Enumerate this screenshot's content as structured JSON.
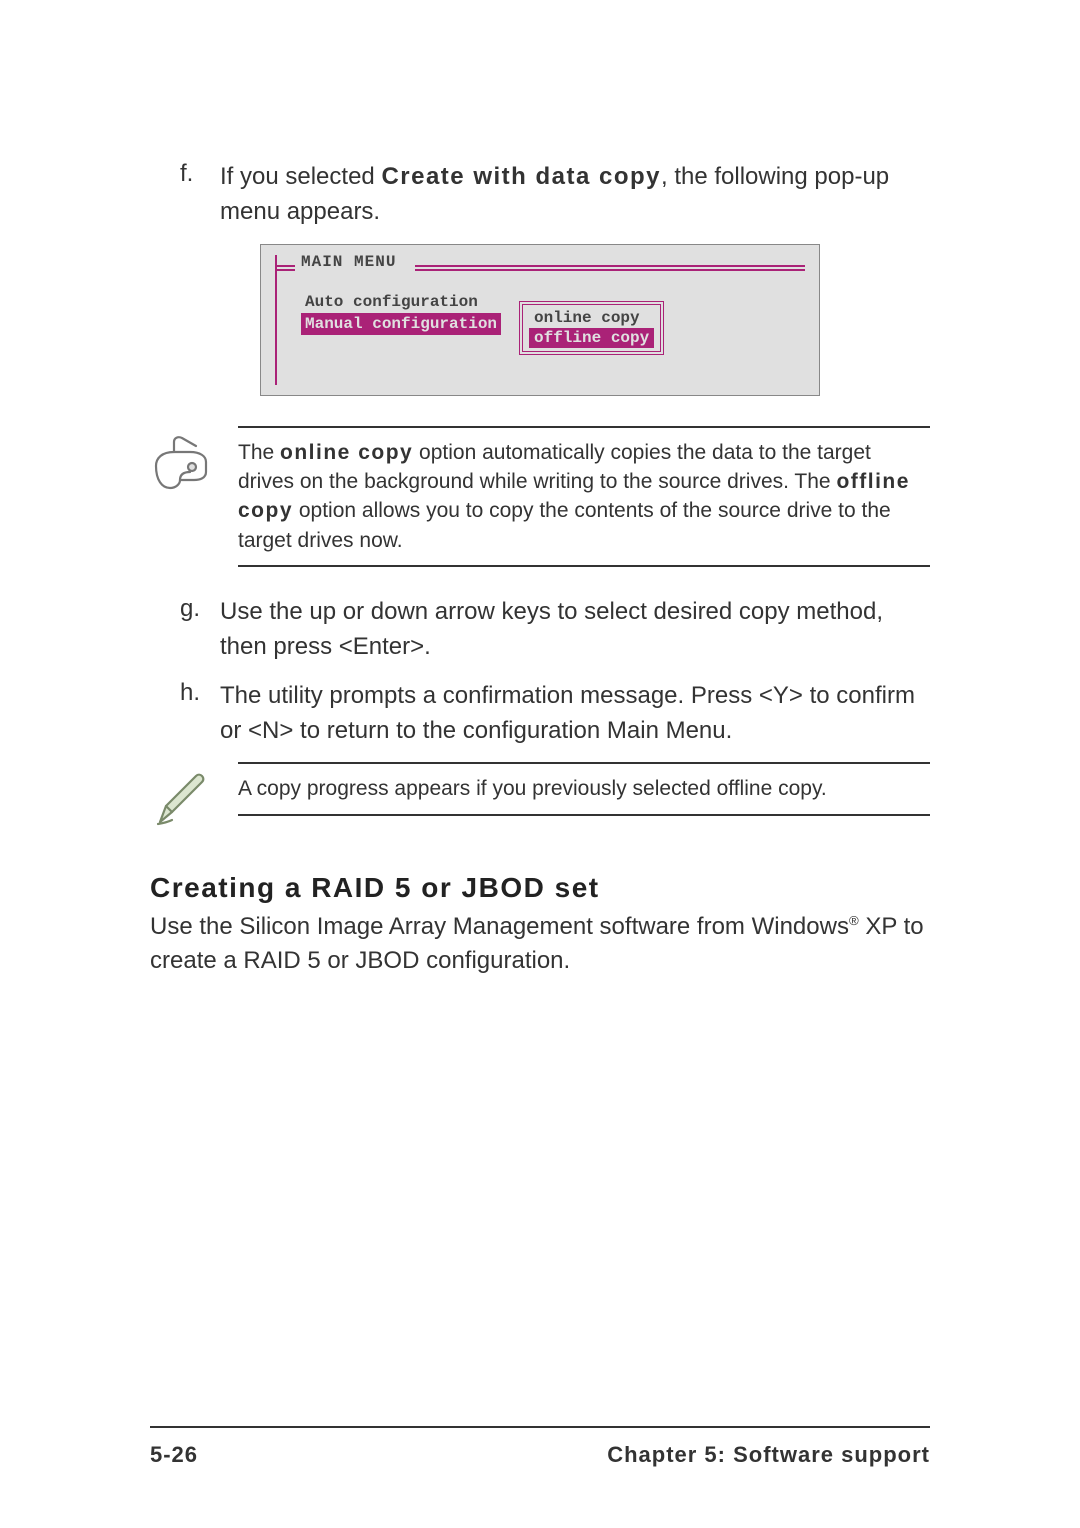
{
  "step_f": {
    "marker": "f.",
    "pre": "If you selected ",
    "bold": "Create with data copy",
    "post": ", the following pop-up menu appears."
  },
  "figure": {
    "main_menu_label": "MAIN MENU",
    "items": [
      "Auto configuration",
      "Manual configuration"
    ],
    "selected_item_index": 1,
    "popup": {
      "options": [
        "online copy",
        "offline copy"
      ],
      "selected_index": 1
    }
  },
  "note1": {
    "parts": [
      {
        "t": "The "
      },
      {
        "t": "online copy",
        "b": true,
        "sp": true
      },
      {
        "t": " option automatically copies the data to the target drives on the background while writing to the source drives. The "
      },
      {
        "t": "offline copy",
        "b": true,
        "sp": true
      },
      {
        "t": " option allows you to copy the contents of the source drive to the target drives now."
      }
    ]
  },
  "step_g": {
    "marker": "g.",
    "text": "Use the up or down arrow keys to select desired copy method, then press <Enter>."
  },
  "step_h": {
    "marker": "h.",
    "text": "The utility prompts a confirmation message. Press <Y> to confirm or <N> to return to the configuration Main Menu."
  },
  "note2": {
    "text": "A copy progress appears if you previously selected offline copy."
  },
  "section": {
    "heading": "Creating a RAID 5 or JBOD set",
    "body_pre": "Use the Silicon Image Array Management software from Windows",
    "reg": "®",
    "body_post": " XP to create a RAID 5 or JBOD configuration."
  },
  "footer": {
    "page_num": "5-26",
    "chapter": "Chapter 5: Software support"
  }
}
